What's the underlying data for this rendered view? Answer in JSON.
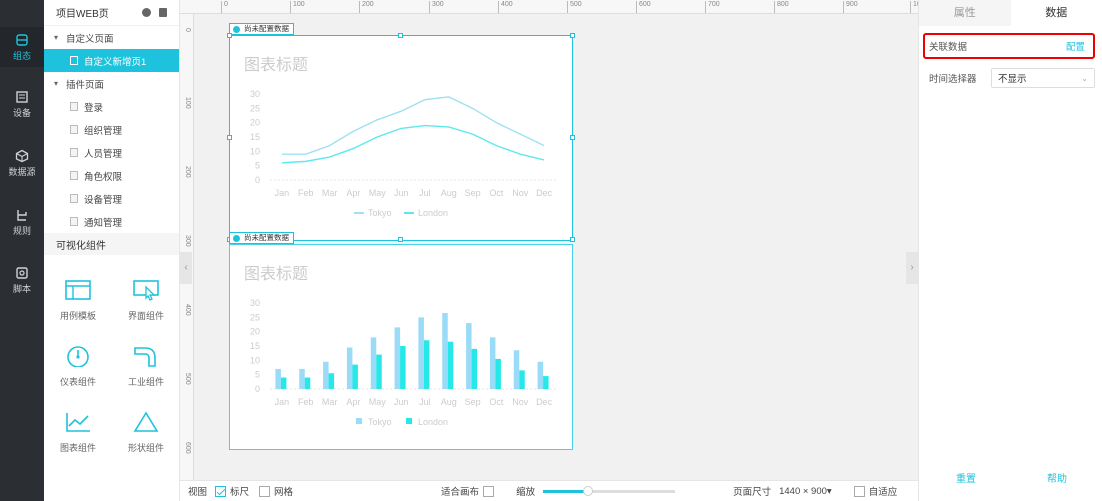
{
  "rail": [
    {
      "label": "组态",
      "icon": "layers-icon",
      "active": true
    },
    {
      "label": "设备",
      "icon": "device-icon",
      "active": false
    },
    {
      "label": "数据源",
      "icon": "cube-icon",
      "active": false
    },
    {
      "label": "规则",
      "icon": "rule-icon",
      "active": false
    },
    {
      "label": "脚本",
      "icon": "script-icon",
      "active": false
    }
  ],
  "tree": {
    "title": "项目WEB页",
    "group1": {
      "label": "自定义页面",
      "items": [
        "自定义新增页1"
      ]
    },
    "group2": {
      "label": "插件页面",
      "items": [
        "登录",
        "组织管理",
        "人员管理",
        "角色权限",
        "设备管理",
        "通知管理"
      ]
    }
  },
  "components": {
    "section": "可视化组件",
    "items": [
      {
        "label": "用例模板",
        "icon": "template-icon"
      },
      {
        "label": "界面组件",
        "icon": "cursor-window-icon"
      },
      {
        "label": "仪表组件",
        "icon": "gauge-icon"
      },
      {
        "label": "工业组件",
        "icon": "pipe-icon"
      },
      {
        "label": "图表组件",
        "icon": "line-chart-icon"
      },
      {
        "label": "形状组件",
        "icon": "triangle-icon"
      }
    ]
  },
  "ruler": {
    "top": [
      "0",
      "100",
      "200",
      "300",
      "400",
      "500",
      "600",
      "700",
      "800",
      "900",
      "10"
    ],
    "left": [
      "0",
      "100",
      "200",
      "300",
      "400",
      "500",
      "600"
    ]
  },
  "canvas": {
    "badge": "尚未配置数据",
    "badge2": "尚未配置数据"
  },
  "chart_data": [
    {
      "type": "line",
      "title": "图表标题",
      "categories": [
        "Jan",
        "Feb",
        "Mar",
        "Apr",
        "May",
        "Jun",
        "Jul",
        "Aug",
        "Sep",
        "Oct",
        "Nov",
        "Dec"
      ],
      "series": [
        {
          "name": "Tokyo",
          "values": [
            9,
            9,
            12,
            17,
            21,
            24,
            28,
            29,
            25,
            20,
            16,
            12
          ],
          "color": "#9fe0f2"
        },
        {
          "name": "London",
          "values": [
            6,
            6.5,
            8,
            11,
            15,
            18,
            19,
            18.5,
            16,
            12,
            9,
            7
          ],
          "color": "#5ee8ee"
        }
      ],
      "y_ticks": [
        "0",
        "5",
        "10",
        "15",
        "20",
        "25",
        "30"
      ],
      "ylim": [
        0,
        30
      ],
      "legend": "bottom-center"
    },
    {
      "type": "bar",
      "title": "图表标题",
      "categories": [
        "Jan",
        "Feb",
        "Mar",
        "Apr",
        "May",
        "Jun",
        "Jul",
        "Aug",
        "Sep",
        "Oct",
        "Nov",
        "Dec"
      ],
      "series": [
        {
          "name": "Tokyo",
          "values": [
            7,
            7,
            9.5,
            14.5,
            18,
            21.5,
            25,
            26.5,
            23,
            18,
            13.5,
            9.5
          ],
          "color": "#9adcf8"
        },
        {
          "name": "London",
          "values": [
            4,
            4,
            5.5,
            8.5,
            12,
            15,
            17,
            16.5,
            14,
            10.5,
            6.5,
            4.5
          ],
          "color": "#27e8e8"
        }
      ],
      "y_ticks": [
        "0",
        "5",
        "10",
        "15",
        "20",
        "25",
        "30"
      ],
      "ylim": [
        0,
        30
      ],
      "legend": "bottom-center"
    }
  ],
  "bottom": {
    "view": "视图",
    "ruler": "标尺",
    "grid": "网格",
    "fit": "适合画布",
    "zoom": "缩放",
    "zoom_value": 0.34,
    "page_size_label": "页面尺寸",
    "page_size_value": "1440 × 900▾",
    "auto_fit": "自适应"
  },
  "right": {
    "tabs": [
      "属性",
      "数据"
    ],
    "bind_label": "关联数据",
    "bind_action": "配置",
    "time_label": "时间选择器",
    "time_value": "不显示",
    "reset": "重置",
    "help": "帮助"
  },
  "colors": {
    "accent": "#1fc2dc",
    "rail_bg": "#2b2f33",
    "highlight": "#e00000"
  }
}
